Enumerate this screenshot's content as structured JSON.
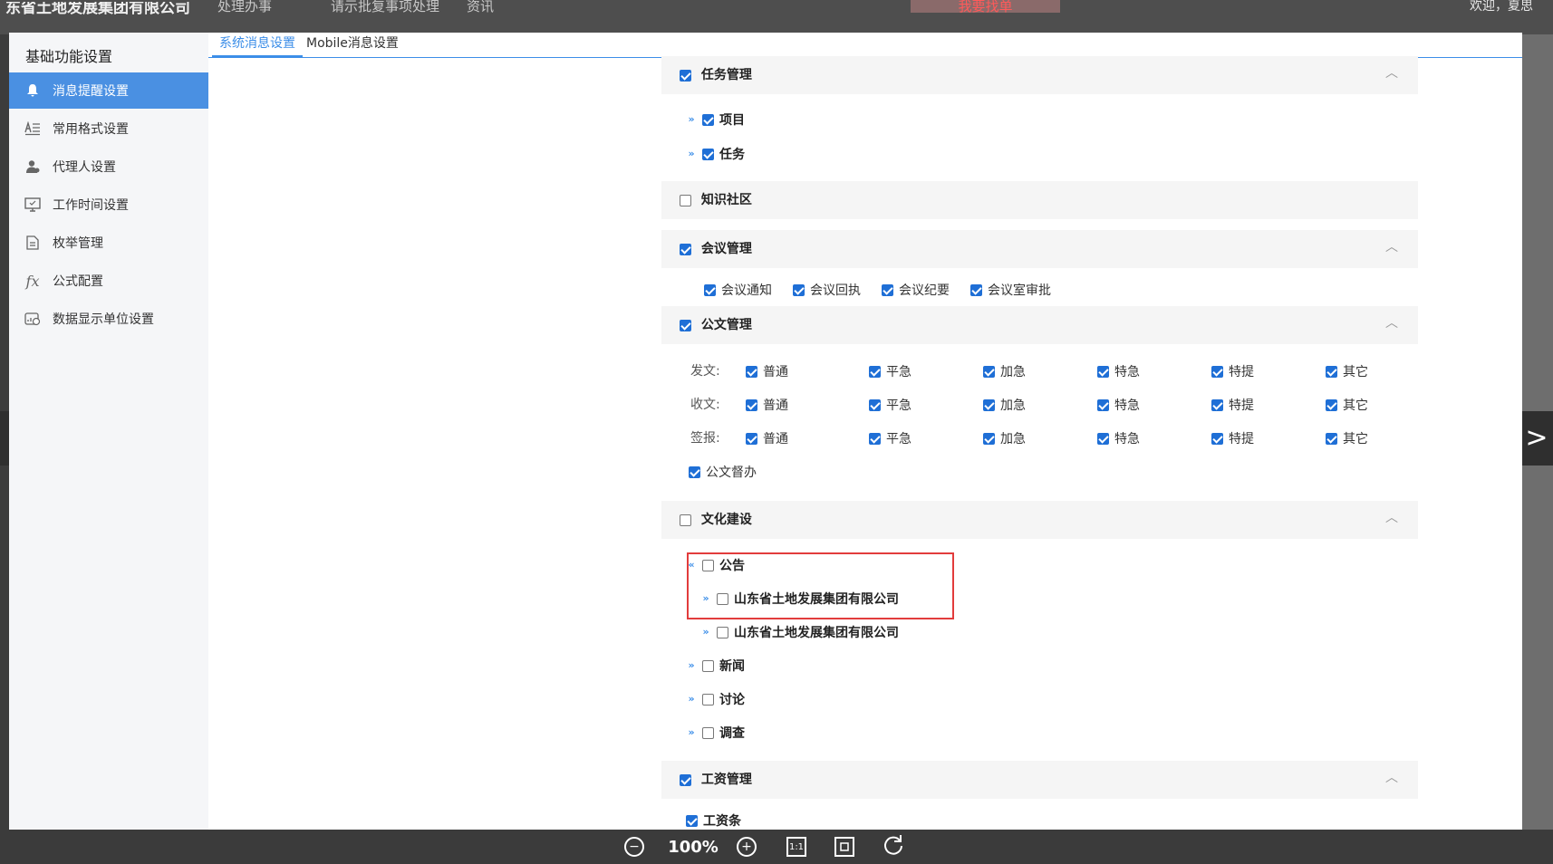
{
  "background": {
    "title": "东省土地发展集团有限公司",
    "tabs": [
      "处理办事",
      "请示批复事项处理",
      "资讯"
    ],
    "red_tab": "我要找单",
    "right_tab": "欢迎，夏思"
  },
  "sidebar": {
    "title": "基础功能设置",
    "items": [
      {
        "label": "消息提醒设置",
        "icon": "bell-icon"
      },
      {
        "label": "常用格式设置",
        "icon": "format-icon"
      },
      {
        "label": "代理人设置",
        "icon": "person-icon"
      },
      {
        "label": "工作时间设置",
        "icon": "monitor-icon"
      },
      {
        "label": "枚举管理",
        "icon": "document-icon"
      },
      {
        "label": "公式配置",
        "icon": "fx-icon"
      },
      {
        "label": "数据显示单位设置",
        "icon": "data-unit-icon"
      }
    ]
  },
  "tabs": [
    "系统消息设置",
    "Mobile消息设置"
  ],
  "sections": {
    "task": {
      "title": "任务管理",
      "checked": true,
      "children": [
        "项目",
        "任务"
      ]
    },
    "knowledge": {
      "title": "知识社区",
      "checked": false
    },
    "meeting": {
      "title": "会议管理",
      "checked": true,
      "options": [
        "会议通知",
        "会议回执",
        "会议纪要",
        "会议室审批"
      ]
    },
    "doc": {
      "title": "公文管理",
      "checked": true,
      "categories": [
        "发文:",
        "收文:",
        "签报:"
      ],
      "options": [
        "普通",
        "平急",
        "加急",
        "特急",
        "特提",
        "其它"
      ],
      "extra": "公文督办"
    },
    "culture": {
      "title": "文化建设",
      "checked": false,
      "announcement": "公告",
      "sub_items": [
        "山东省土地发展集团有限公司",
        "山东省土地发展集团有限公司"
      ],
      "others": [
        "新闻",
        "讨论",
        "调查"
      ]
    },
    "salary": {
      "title": "工资管理",
      "checked": true,
      "children": [
        "工资条"
      ]
    }
  },
  "toolbar": {
    "zoom": "100%",
    "actual_size": "1:1"
  }
}
